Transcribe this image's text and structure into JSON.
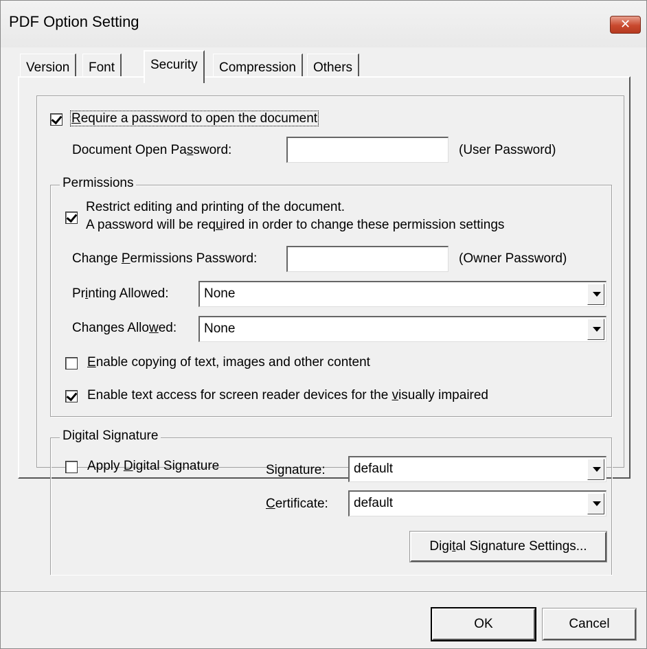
{
  "window": {
    "title": "PDF Option Setting",
    "close_symbol": "✕"
  },
  "tabs": [
    {
      "label": "Version",
      "active": false
    },
    {
      "label": "Font",
      "active": false
    },
    {
      "label": "Security",
      "active": true
    },
    {
      "label": "Compression",
      "active": false
    },
    {
      "label": "Others",
      "active": false
    }
  ],
  "security": {
    "require_password": {
      "checked": true,
      "label_pre": "",
      "label_key": "R",
      "label_post": "equire a password to open the document"
    },
    "open_password": {
      "label_pre": "Document Open Pa",
      "label_key": "s",
      "label_post": "sword:",
      "value": "",
      "note": "(User Password)"
    },
    "permissions": {
      "group_label": "Permissions",
      "restrict": {
        "checked": true,
        "line1": "Restrict editing and printing of the document.",
        "line2_pre": "A password will be req",
        "line2_key": "u",
        "line2_post": "ired in order to change these permission settings"
      },
      "change_password": {
        "label_pre": "Change ",
        "label_key": "P",
        "label_post": "ermissions Password:",
        "value": "",
        "note": "(Owner Password)"
      },
      "printing": {
        "label_pre": "Pr",
        "label_key": "i",
        "label_post": "nting Allowed:",
        "value": "None"
      },
      "changes": {
        "label_pre": "Changes Allo",
        "label_key": "w",
        "label_post": "ed:",
        "value": "None"
      },
      "enable_copying": {
        "checked": false,
        "label_pre": "",
        "label_key": "E",
        "label_post": "nable copying of text, images and other content"
      },
      "enable_text_access": {
        "checked": true,
        "label_pre": "Enable text access for screen reader devices for the ",
        "label_key": "v",
        "label_post": "isually impaired"
      }
    },
    "digital_signature": {
      "group_label": "Digital Signature",
      "apply": {
        "checked": false,
        "label_pre": "Apply ",
        "label_key": "D",
        "label_post": "igital Signature"
      },
      "signature": {
        "label_pre": "Si",
        "label_key": "g",
        "label_post": "nature:",
        "value": "default"
      },
      "certificate": {
        "label_pre": "",
        "label_key": "C",
        "label_post": "ertificate:",
        "value": "default"
      },
      "settings_button": {
        "label_pre": "Digi",
        "label_key": "t",
        "label_post": "al Signature Settings..."
      }
    }
  },
  "footer": {
    "ok_label": "OK",
    "cancel_label": "Cancel"
  }
}
